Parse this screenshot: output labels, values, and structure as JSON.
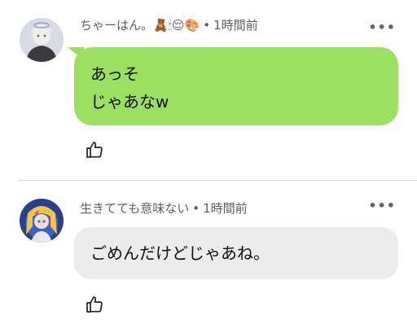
{
  "comments": [
    {
      "author": "ちゃーはん。🧸🕯😌🎨",
      "time": "1時間前",
      "lines": [
        "あっそ",
        "じゃあなw"
      ],
      "bubble_color": "#9be060"
    },
    {
      "author": "生きてても意味ない",
      "time": "1時間前",
      "lines": [
        "ごめんだけどじゃあね。"
      ],
      "bubble_color": "#ececec"
    }
  ],
  "separator": "•",
  "more_label": "•••",
  "icons": {
    "more": "more-options-icon",
    "like": "thumbs-up-icon",
    "avatar": "avatar"
  }
}
